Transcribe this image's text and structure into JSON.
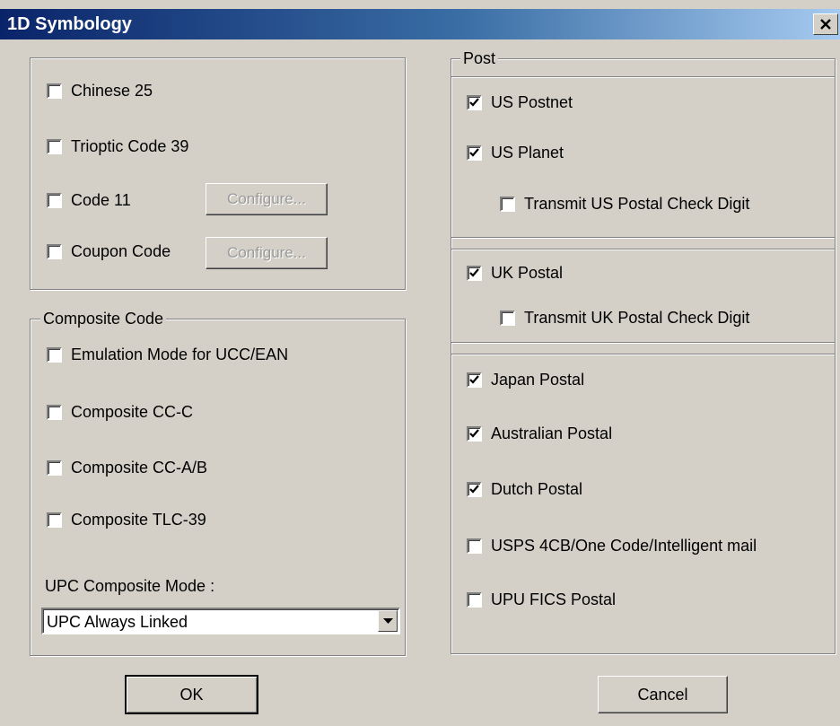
{
  "window": {
    "title": "1D Symbology",
    "close_icon": "close-icon"
  },
  "misc_group": {
    "items": [
      {
        "label": "Chinese 25",
        "checked": false
      },
      {
        "label": "Trioptic Code 39",
        "checked": false
      },
      {
        "label": "Code 11",
        "checked": false
      },
      {
        "label": "Coupon Code",
        "checked": false
      }
    ],
    "configure_label": "Configure..."
  },
  "composite_group": {
    "legend": "Composite Code",
    "items": [
      {
        "label": "Emulation Mode for UCC/EAN",
        "checked": false
      },
      {
        "label": "Composite CC-C",
        "checked": false
      },
      {
        "label": "Composite CC-A/B",
        "checked": false
      },
      {
        "label": "Composite TLC-39",
        "checked": false
      }
    ],
    "upc_mode_label": "UPC Composite Mode :",
    "upc_mode_value": "UPC Always Linked"
  },
  "post_group": {
    "legend": "Post",
    "items": [
      {
        "label": "US Postnet",
        "checked": true
      },
      {
        "label": "US Planet",
        "checked": true
      },
      {
        "label": "Transmit US Postal Check Digit",
        "checked": false
      },
      {
        "label": "UK Postal",
        "checked": true
      },
      {
        "label": "Transmit UK Postal Check Digit",
        "checked": false
      },
      {
        "label": "Japan Postal",
        "checked": true
      },
      {
        "label": "Australian Postal",
        "checked": true
      },
      {
        "label": "Dutch Postal",
        "checked": true
      },
      {
        "label": "USPS 4CB/One Code/Intelligent mail",
        "checked": false
      },
      {
        "label": "UPU FICS Postal",
        "checked": false
      }
    ]
  },
  "buttons": {
    "ok": "OK",
    "cancel": "Cancel"
  },
  "colors": {
    "dialog_face": "#d4d0c8",
    "title_start": "#0a246a",
    "title_end": "#a6caf0"
  }
}
